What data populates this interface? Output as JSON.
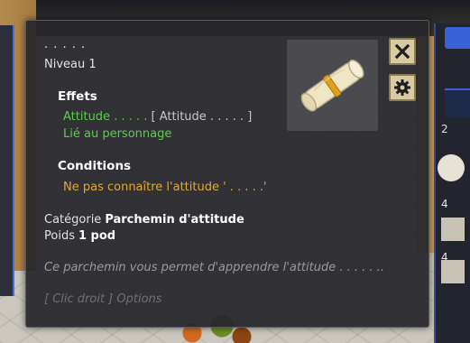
{
  "hud": {
    "values": [
      "2",
      "4",
      "4"
    ]
  },
  "tooltip": {
    "item_name": ". . . . .",
    "level": "Niveau 1",
    "effects_title": "Effets",
    "effect_name": "Attitude . . . . .",
    "effect_bracket": "[ Attitude . . . . . ]",
    "effect_link": "Lié au personnage",
    "conditions_title": "Conditions",
    "condition": "Ne pas connaître l'attitude ' . . . . .'",
    "category_label": "Catégorie",
    "category_value": "Parchemin d'attitude",
    "weight_label": "Poids",
    "weight_value": "1 pod",
    "description": "Ce parchemin vous permet d'apprendre l'attitude . . . . . ..",
    "hint": "[ Clic droit ] Options"
  },
  "icons": {
    "item": "scroll-icon",
    "close": "close-icon",
    "options": "gear-icon"
  },
  "colors": {
    "effect_green": "#58d04a",
    "condition_orange": "#e3a832",
    "panel_bg": "#26262a",
    "button_bg": "#d8cba4"
  }
}
